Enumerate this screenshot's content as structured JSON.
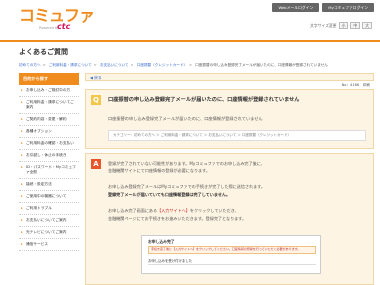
{
  "header": {
    "logo_main": "コミュファ",
    "logo_sub": "Powered by",
    "logo_brand": "ctc",
    "buttons": [
      "Webメールログイン",
      "Myコミュファログイン"
    ]
  },
  "page": {
    "title": "よくあるご質問",
    "font_size_label": "文字サイズ変更",
    "font_size_options": [
      "小",
      "中",
      "大"
    ]
  },
  "breadcrumb": [
    "初めての方へ",
    "ご利用料金・請求について",
    "お支払いについて",
    "口座振替（クレジットカード）",
    "口座振替の申し込み登録完了メールが届いたのに、口座情報が登録されていません"
  ],
  "sidebar": {
    "heading": "目的から探す",
    "items": [
      "お申し込み・ご検討中の方",
      "ご利用料金・請求についてご案内",
      "ご契約内容・変更・解約",
      "各種オプション",
      "ご利用料金の確認・お支払い",
      "お引越し・休止の手続き",
      "ID・パスワード・Myコミュファ全般",
      "接続・設定方法",
      "ご使用中の機器について",
      "ご利用トラブル",
      "お支払いについてご案内",
      "光テレビについてご案内",
      "通信サービス"
    ]
  },
  "main": {
    "back_label": "◀ 戻る",
    "doc_info": "No：4166　印刷",
    "question": {
      "mark": "Q",
      "title": "口座振替の申し込み登録完了メールが届いたのに、口座情報が登録されていません",
      "text": "口座振替の申し込み登録完了メールが届いたのに、口座情報が登録されていません",
      "category": "カテゴリー：初めての方へ ＞ ご利用料金・請求について ＞ お支払いについて ＞ 口座振替（クレジットカード）"
    },
    "answer": {
      "mark": "A",
      "lines": [
        "登録が完了されていない可能性があります。Myコミュファでのお申し込み完了後に、",
        "金融機関サイトにて口座情報の登録が必要になります。",
        "お申し込み登録完了メールはMyコミュファでの手続きが完了した際に送信されます。",
        "登録完了メールが届いていても口座情報登録は完了していません。",
        "お申し込み完了画面にある【入力サイトへ】をクリックしていただき、",
        "金融機関ページにてお手続きをお進みいただきます。登録完了となります。"
      ],
      "highlight": "【入力サイトへ】"
    },
    "screenshot": {
      "heading": "お申し込み完了",
      "note": "手続き完了後に【入力サイトへ】をクリックしてください。口座情報の登録を行っていただく必要があります。",
      "sub": "お申し込みを受け付けました"
    }
  }
}
